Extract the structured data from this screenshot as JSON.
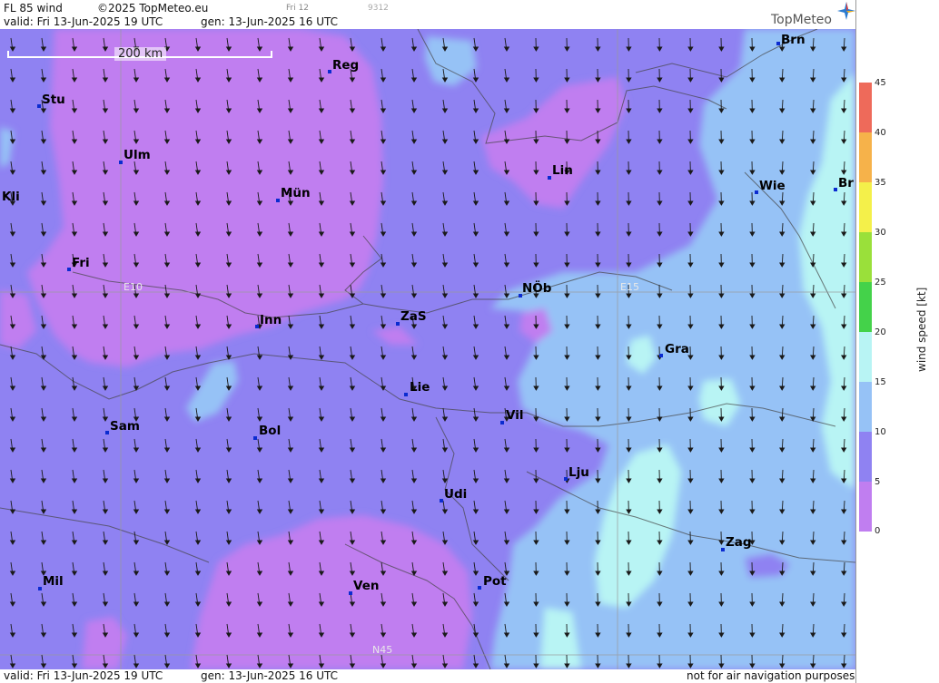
{
  "header": {
    "product": "FL 85 wind",
    "copyright": "©2025 TopMeteo.eu",
    "day_tab": "Fri 12",
    "code": "9312",
    "valid": "valid:  Fri  13-Jun-2025  19 UTC",
    "gen": "gen: 13-Jun-2025 16 UTC",
    "logo": "TopMeteo"
  },
  "footer": {
    "valid": "valid:  Fri  13-Jun-2025  19 UTC",
    "gen": "gen: 13-Jun-2025 16 UTC",
    "disclaimer": "not for air navigation purposes"
  },
  "scale_bar": {
    "label": "200 km"
  },
  "grid_labels": {
    "lon1": "E10",
    "lon2": "E15",
    "lat1": "N45"
  },
  "cities": [
    {
      "name": "Brn"
    },
    {
      "name": "Reg"
    },
    {
      "name": "Stu"
    },
    {
      "name": "Ulm"
    },
    {
      "name": "Kli"
    },
    {
      "name": "Mün"
    },
    {
      "name": "Lin"
    },
    {
      "name": "Wie"
    },
    {
      "name": "Br"
    },
    {
      "name": "Fri"
    },
    {
      "name": "NÖb"
    },
    {
      "name": "ZaS"
    },
    {
      "name": "Inn"
    },
    {
      "name": "Gra"
    },
    {
      "name": "Lie"
    },
    {
      "name": "Vil"
    },
    {
      "name": "Sam"
    },
    {
      "name": "Bol"
    },
    {
      "name": "Lju"
    },
    {
      "name": "Udi"
    },
    {
      "name": "Zag"
    },
    {
      "name": "Mil"
    },
    {
      "name": "Ven"
    },
    {
      "name": "Pot"
    }
  ],
  "legend": {
    "title": "wind speed [kt]",
    "ticks": [
      "45",
      "40",
      "35",
      "30",
      "25",
      "20",
      "15",
      "10",
      "5",
      "0"
    ],
    "colors": {
      "0-5": "#c07ef0",
      "5-10": "#8f82f2",
      "10-15": "#96c2f6",
      "15-20": "#b8f4f4",
      "20-25": "#44d24a",
      "25-30": "#9ae03a",
      "30-35": "#f4f04a",
      "35-40": "#f6b24a",
      "40-45": "#ee6a5a"
    }
  }
}
